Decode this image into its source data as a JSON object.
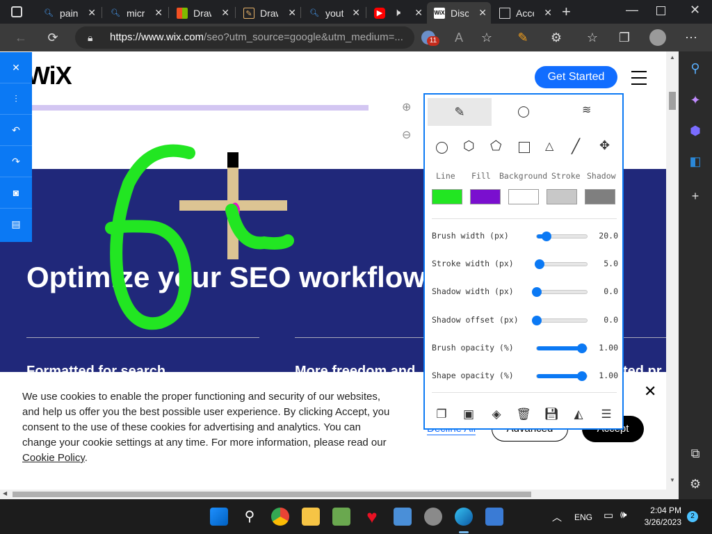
{
  "browser": {
    "tabs": [
      {
        "title": "pain",
        "favicon": "search-icon"
      },
      {
        "title": "micr",
        "favicon": "search-icon"
      },
      {
        "title": "Draw",
        "favicon": "microsoft-logo-icon"
      },
      {
        "title": "Draw",
        "favicon": "drawing-app-icon"
      },
      {
        "title": "yout",
        "favicon": "search-icon"
      },
      {
        "title": "",
        "favicon": "youtube-icon"
      },
      {
        "title": "Disc",
        "favicon": "wix-icon",
        "active": true
      },
      {
        "title": "Acce",
        "favicon": "document-icon"
      }
    ],
    "url_domain": "https://www.wix.com",
    "url_path": "/seo?utm_source=google&utm_medium=...",
    "extension_badge": "11"
  },
  "wix": {
    "logo": "WiX",
    "get_started": "Get Started",
    "hero_title": "Optimize your SEO workflow",
    "col1_title": "Formatted for search",
    "col2_title": "More freedom and",
    "col3_title": "ted pr"
  },
  "cookie": {
    "text1": "We use cookies to enable the proper functioning and security of our websites, and help us offer you the best possible user experience. By clicking Accept, you consent to the use of these cookies for advertising and analytics. You can change your cookie settings at any time. For more information, please read our ",
    "link": "Cookie Policy",
    "text2": ".",
    "decline_label": "Decline All",
    "advanced_label": "Advanced",
    "accept_label": "Accept"
  },
  "draw_panel": {
    "col_labels": [
      "Line",
      "Fill",
      "Background",
      "Stroke",
      "Shadow"
    ],
    "colors": {
      "line": "#22e622",
      "fill": "#7a0fcf",
      "background": "#ffffff",
      "stroke": "#c8c8c8",
      "shadow": "#7f7f7f"
    },
    "sliders": [
      {
        "label": "Brush width (px)",
        "value": "20.0",
        "fraction": 0.2
      },
      {
        "label": "Stroke width (px)",
        "value": "5.0",
        "fraction": 0.05
      },
      {
        "label": "Shadow width (px)",
        "value": "0.0",
        "fraction": 0.0
      },
      {
        "label": "Shadow offset (px)",
        "value": "0.0",
        "fraction": 0.0
      },
      {
        "label": "Brush opacity (%)",
        "value": "1.00",
        "fraction": 0.9
      },
      {
        "label": "Shape opacity (%)",
        "value": "1.00",
        "fraction": 0.9
      }
    ]
  },
  "taskbar": {
    "time": "2:04 PM",
    "date": "3/26/2023",
    "lang": "ENG",
    "notif_count": "2"
  }
}
